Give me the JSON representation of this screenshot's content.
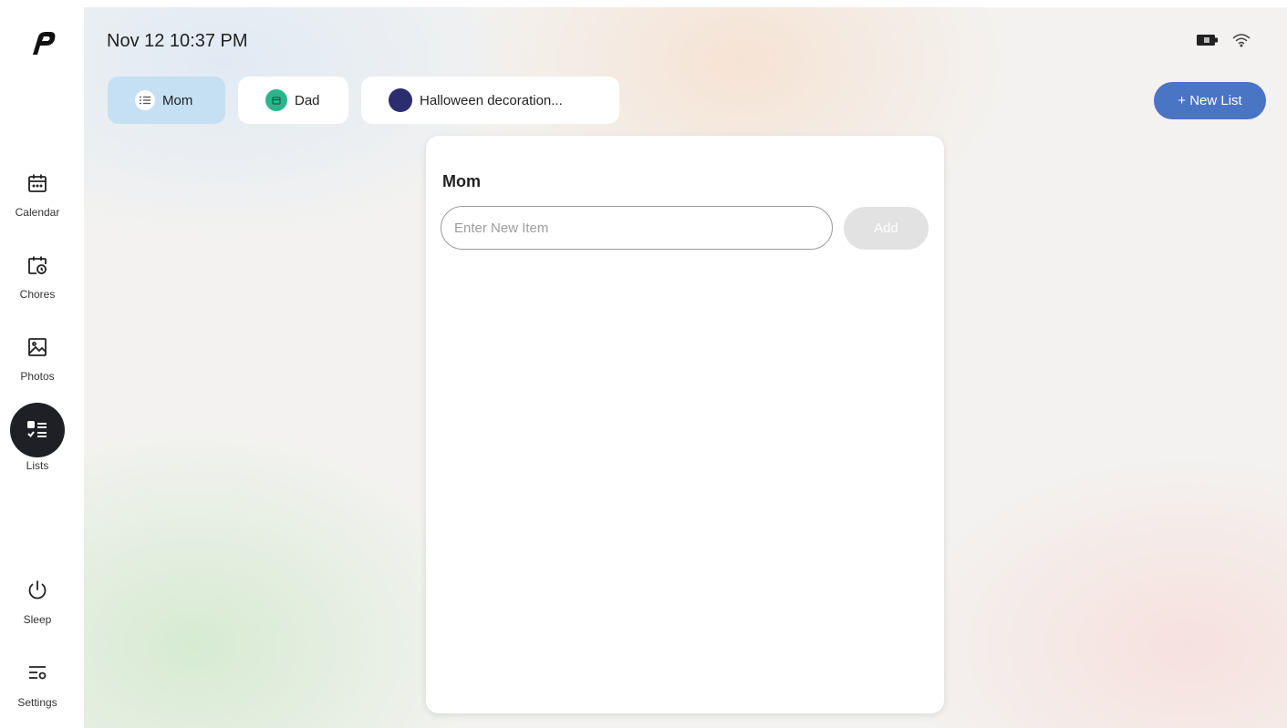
{
  "app": {
    "logo": "brand-logo"
  },
  "status_bar": {
    "datetime": "Nov 12 10:37 PM",
    "icons": [
      "battery-icon",
      "wifi-icon"
    ]
  },
  "sidebar": {
    "items": [
      {
        "label": "Calendar",
        "icon": "calendar-icon",
        "active": false
      },
      {
        "label": "Chores",
        "icon": "chores-icon",
        "active": false
      },
      {
        "label": "Photos",
        "icon": "photos-icon",
        "active": false
      },
      {
        "label": "Lists",
        "icon": "lists-icon",
        "active": true
      },
      {
        "label": "Sleep",
        "icon": "power-icon",
        "active": false
      },
      {
        "label": "Settings",
        "icon": "settings-icon",
        "active": false
      }
    ]
  },
  "tabs": [
    {
      "label": "Mom",
      "icon": "list-icon",
      "color": "#c5e0f2",
      "active": true
    },
    {
      "label": "Dad",
      "icon": "calendar-small-icon",
      "color": "#2bb58a",
      "active": false
    },
    {
      "label": "Halloween decoration...",
      "icon": "color-dot",
      "color": "#2b2d6e",
      "active": false
    }
  ],
  "new_list": {
    "label": "+ New List",
    "color": "#4a74c4"
  },
  "panel": {
    "title": "Mom",
    "input": {
      "placeholder": "Enter New Item",
      "value": ""
    },
    "add_label": "Add"
  }
}
